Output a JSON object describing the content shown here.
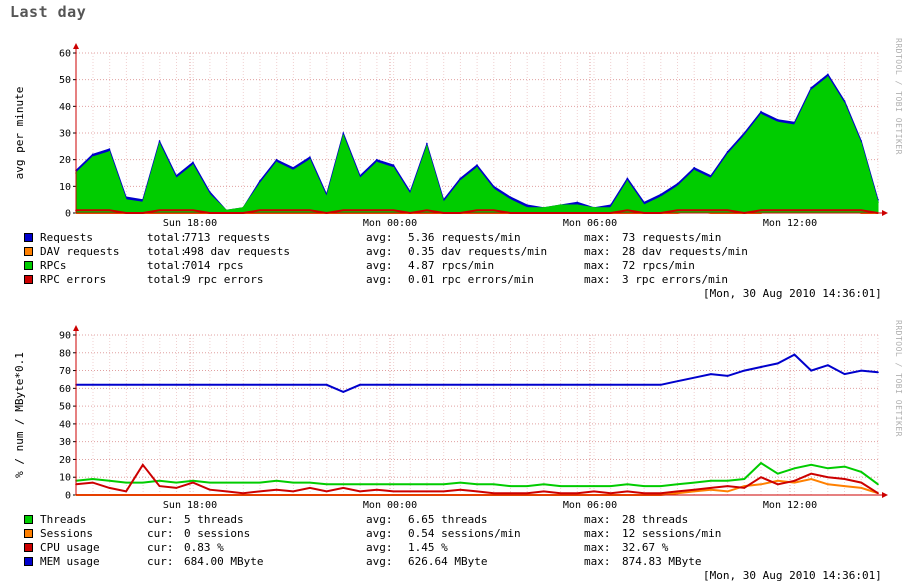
{
  "title": "Last day",
  "watermark": "RRDTOOL / TOBI OETIKER",
  "colors": {
    "blue": "#0000cc",
    "orange": "#ff8000",
    "green": "#00cc00",
    "red": "#cc0000",
    "grid": "#e0a0a0",
    "minor_grid": "#f0d0d0"
  },
  "charts": [
    {
      "id": "requests",
      "ylabel": "avg per minute",
      "x_ticks": [
        "Sun 18:00",
        "Mon 00:00",
        "Mon 06:00",
        "Mon 12:00"
      ],
      "legend": [
        {
          "name": "Requests",
          "color": "#0000cc",
          "c1": "total:",
          "v1": "7713 requests",
          "c2": "avg:",
          "v2": "5.36 requests/min",
          "c3": "max:",
          "v3": "73 requests/min"
        },
        {
          "name": "DAV requests",
          "color": "#ff8000",
          "c1": "total:",
          "v1": "498 dav requests",
          "c2": "avg:",
          "v2": "0.35 dav requests/min",
          "c3": "max:",
          "v3": "28 dav requests/min"
        },
        {
          "name": "RPCs",
          "color": "#00cc00",
          "c1": "total:",
          "v1": "7014 rpcs",
          "c2": "avg:",
          "v2": "4.87 rpcs/min",
          "c3": "max:",
          "v3": "72 rpcs/min"
        },
        {
          "name": "RPC errors",
          "color": "#cc0000",
          "c1": "total:",
          "v1": "9 rpc errors",
          "c2": "avg:",
          "v2": "0.01 rpc errors/min",
          "c3": "max:",
          "v3": "3 rpc errors/min"
        }
      ],
      "timestamp": "[Mon, 30 Aug 2010 14:36:01]"
    },
    {
      "id": "resources",
      "ylabel": "% / num / MByte*0.1",
      "x_ticks": [
        "Sun 18:00",
        "Mon 00:00",
        "Mon 06:00",
        "Mon 12:00"
      ],
      "legend": [
        {
          "name": "Threads",
          "color": "#00cc00",
          "c1": "cur:",
          "v1": "5 threads",
          "c2": "avg:",
          "v2": "6.65 threads",
          "c3": "max:",
          "v3": "28 threads"
        },
        {
          "name": "Sessions",
          "color": "#ff8000",
          "c1": "cur:",
          "v1": "0 sessions",
          "c2": "avg:",
          "v2": "0.54 sessions/min",
          "c3": "max:",
          "v3": "12 sessions/min"
        },
        {
          "name": "CPU usage",
          "color": "#cc0000",
          "c1": "cur:",
          "v1": "0.83 %",
          "c2": "avg:",
          "v2": "1.45 %",
          "c3": "max:",
          "v3": "32.67 %"
        },
        {
          "name": "MEM usage",
          "color": "#0000cc",
          "c1": "cur:",
          "v1": "684.00 MByte",
          "c2": "avg:",
          "v2": "626.64 MByte",
          "c3": "max:",
          "v3": "874.83 MByte"
        }
      ],
      "timestamp": "[Mon, 30 Aug 2010 14:36:01]"
    }
  ],
  "chart_data": [
    {
      "type": "area",
      "ylabel": "avg per minute",
      "ylim": [
        0,
        60
      ],
      "y_ticks": [
        0,
        10,
        20,
        30,
        40,
        50,
        60
      ],
      "x_ticks": [
        "Sun 18:00",
        "Mon 00:00",
        "Mon 06:00",
        "Mon 12:00"
      ],
      "grid": true,
      "x_hours_from_start": [
        0,
        0.5,
        1,
        1.5,
        2,
        2.5,
        3,
        3.5,
        4,
        4.5,
        5,
        5.5,
        6,
        6.5,
        7,
        7.5,
        8,
        8.5,
        9,
        9.5,
        10,
        10.5,
        11,
        11.5,
        12,
        12.5,
        13,
        13.5,
        14,
        14.5,
        15,
        15.5,
        16,
        16.5,
        17,
        17.5,
        18,
        18.5,
        19,
        19.5,
        20,
        20.5,
        21,
        21.5,
        22,
        22.5,
        23,
        23.5,
        24
      ],
      "series": [
        {
          "name": "Requests",
          "values": [
            16,
            22,
            24,
            6,
            5,
            27,
            14,
            19,
            8,
            1,
            2,
            12,
            20,
            17,
            21,
            7,
            30,
            14,
            20,
            18,
            8,
            26,
            5,
            13,
            18,
            10,
            6,
            3,
            2,
            3,
            4,
            2,
            3,
            13,
            4,
            7,
            11,
            17,
            14,
            23,
            30,
            38,
            35,
            34,
            47,
            52,
            42,
            27,
            5
          ]
        },
        {
          "name": "DAV requests",
          "values": [
            0,
            0,
            0,
            0,
            0,
            0,
            0,
            0,
            0,
            0,
            0,
            0,
            0,
            0,
            0,
            0,
            0,
            0,
            0,
            0,
            0,
            0,
            0,
            0,
            0,
            0,
            0,
            0,
            0,
            0,
            0,
            0,
            0,
            0,
            0,
            0,
            0,
            1,
            0,
            0,
            0,
            0,
            6,
            2,
            4,
            3,
            2,
            0,
            0
          ]
        },
        {
          "name": "RPCs",
          "values": [
            15,
            21,
            23,
            5,
            4,
            26,
            13,
            18,
            7,
            1,
            2,
            11,
            19,
            16,
            20,
            6,
            29,
            13,
            19,
            17,
            7,
            25,
            4,
            12,
            17,
            9,
            5,
            2,
            2,
            3,
            3,
            2,
            2,
            12,
            3,
            6,
            10,
            16,
            13,
            22,
            29,
            37,
            34,
            33,
            46,
            51,
            41,
            26,
            4
          ]
        },
        {
          "name": "RPC errors",
          "values": [
            1,
            1,
            1,
            0,
            0,
            1,
            1,
            1,
            0,
            0,
            0,
            1,
            1,
            1,
            1,
            0,
            1,
            1,
            1,
            1,
            0,
            1,
            0,
            0,
            1,
            1,
            0,
            0,
            0,
            0,
            0,
            0,
            0,
            1,
            0,
            0,
            1,
            1,
            1,
            1,
            0,
            1,
            1,
            1,
            1,
            1,
            1,
            1,
            0
          ]
        }
      ]
    },
    {
      "type": "line",
      "ylabel": "% / num / MByte*0.1",
      "ylim": [
        0,
        90
      ],
      "y_ticks": [
        0,
        10,
        20,
        30,
        40,
        50,
        60,
        70,
        80,
        90
      ],
      "x_ticks": [
        "Sun 18:00",
        "Mon 00:00",
        "Mon 06:00",
        "Mon 12:00"
      ],
      "grid": true,
      "x_hours_from_start": [
        0,
        0.5,
        1,
        1.5,
        2,
        2.5,
        3,
        3.5,
        4,
        4.5,
        5,
        5.5,
        6,
        6.5,
        7,
        7.5,
        8,
        8.5,
        9,
        9.5,
        10,
        10.5,
        11,
        11.5,
        12,
        12.5,
        13,
        13.5,
        14,
        14.5,
        15,
        15.5,
        16,
        16.5,
        17,
        17.5,
        18,
        18.5,
        19,
        19.5,
        20,
        20.5,
        21,
        21.5,
        22,
        22.5,
        23,
        23.5,
        24
      ],
      "series": [
        {
          "name": "Threads",
          "values": [
            8,
            9,
            8,
            7,
            7,
            8,
            7,
            8,
            7,
            7,
            7,
            7,
            8,
            7,
            7,
            6,
            6,
            6,
            6,
            6,
            6,
            6,
            6,
            7,
            6,
            6,
            5,
            5,
            6,
            5,
            5,
            5,
            5,
            6,
            5,
            5,
            6,
            7,
            8,
            8,
            9,
            18,
            12,
            15,
            17,
            15,
            16,
            13,
            6
          ]
        },
        {
          "name": "Sessions",
          "values": [
            0,
            0,
            0,
            0,
            0,
            0,
            0,
            0,
            0,
            0,
            0,
            0,
            0,
            0,
            0,
            0,
            0,
            0,
            0,
            0,
            0,
            0,
            0,
            0,
            0,
            0,
            0,
            0,
            0,
            0,
            0,
            0,
            0,
            0,
            0,
            0,
            1,
            2,
            3,
            2,
            5,
            6,
            8,
            7,
            9,
            6,
            5,
            4,
            1
          ]
        },
        {
          "name": "CPU usage",
          "values": [
            6,
            7,
            4,
            2,
            17,
            5,
            4,
            7,
            3,
            2,
            1,
            2,
            3,
            2,
            4,
            2,
            4,
            2,
            3,
            2,
            2,
            2,
            2,
            3,
            2,
            1,
            1,
            1,
            2,
            1,
            1,
            2,
            1,
            2,
            1,
            1,
            2,
            3,
            4,
            5,
            4,
            10,
            6,
            8,
            12,
            10,
            9,
            7,
            1
          ]
        },
        {
          "name": "MEM usage",
          "values": [
            62,
            62,
            62,
            62,
            62,
            62,
            62,
            62,
            62,
            62,
            62,
            62,
            62,
            62,
            62,
            62,
            58,
            62,
            62,
            62,
            62,
            62,
            62,
            62,
            62,
            62,
            62,
            62,
            62,
            62,
            62,
            62,
            62,
            62,
            62,
            62,
            64,
            66,
            68,
            67,
            70,
            72,
            74,
            79,
            70,
            73,
            68,
            70,
            69
          ]
        }
      ]
    }
  ]
}
